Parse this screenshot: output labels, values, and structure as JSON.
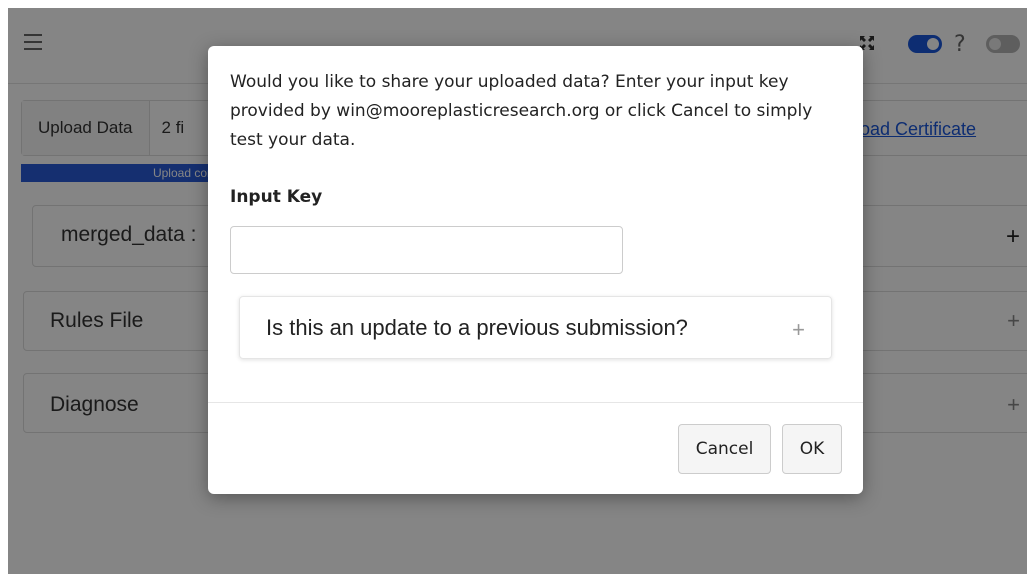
{
  "background": {
    "upload_button": "Upload Data",
    "files_text": "2 fi",
    "progress_text": "Upload com",
    "certificate_link": "oad Certificate",
    "panels": [
      {
        "title": "merged_data :",
        "plus": "+"
      },
      {
        "title": "Rules File",
        "plus": "+"
      },
      {
        "title": "Diagnose",
        "plus": "+"
      }
    ],
    "help": "?"
  },
  "modal": {
    "message": "Would you like to share your uploaded data? Enter your input key provided by win@mooreplasticresearch.org or click Cancel to simply test your data.",
    "input_label": "Input Key",
    "input_value": "",
    "update_question": "Is this an update to a previous submission?",
    "update_plus": "+",
    "cancel_label": "Cancel",
    "ok_label": "OK"
  },
  "colors": {
    "accent": "#1a56db",
    "progress": "#2a5bd7",
    "overlay": "rgba(0,0,0,0.48)"
  }
}
